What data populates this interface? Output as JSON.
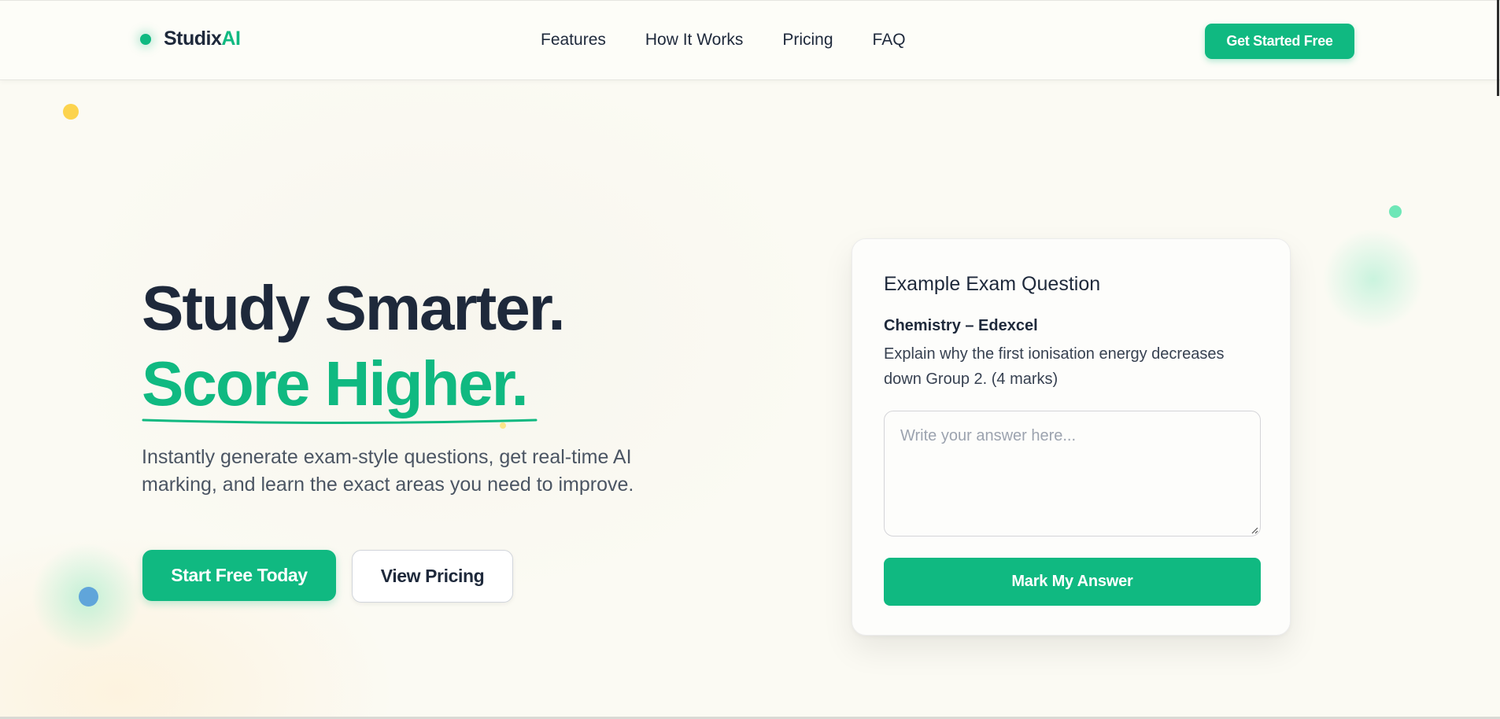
{
  "brand": {
    "name_main": "Studix",
    "name_accent": "AI"
  },
  "nav": {
    "links": [
      "Features",
      "How It Works",
      "Pricing",
      "FAQ"
    ],
    "cta": "Get Started Free"
  },
  "hero": {
    "title_line1": "Study Smarter.",
    "title_line2": "Score Higher.",
    "description": "Instantly generate exam-style questions, get real-time AI marking, and learn the exact areas you need to improve.",
    "primary_button": "Start Free Today",
    "secondary_button": "View Pricing"
  },
  "card": {
    "title": "Example Exam Question",
    "subject": "Chemistry – Edexcel",
    "question": "Explain why the first ionisation energy decreases down Group 2. (4 marks)",
    "answer_placeholder": "Write your answer here...",
    "answer_value": "",
    "submit": "Mark My Answer"
  },
  "colors": {
    "accent": "#10b981",
    "text_dark": "#1e293b",
    "background": "#fbfaf3",
    "deco_yellow": "#fcd34d",
    "deco_blue": "#60a5da",
    "deco_mint": "#6ee7b7"
  },
  "icons": {
    "brand_dot": "brand-dot-icon",
    "textarea_resize": "resize-grip-icon"
  }
}
